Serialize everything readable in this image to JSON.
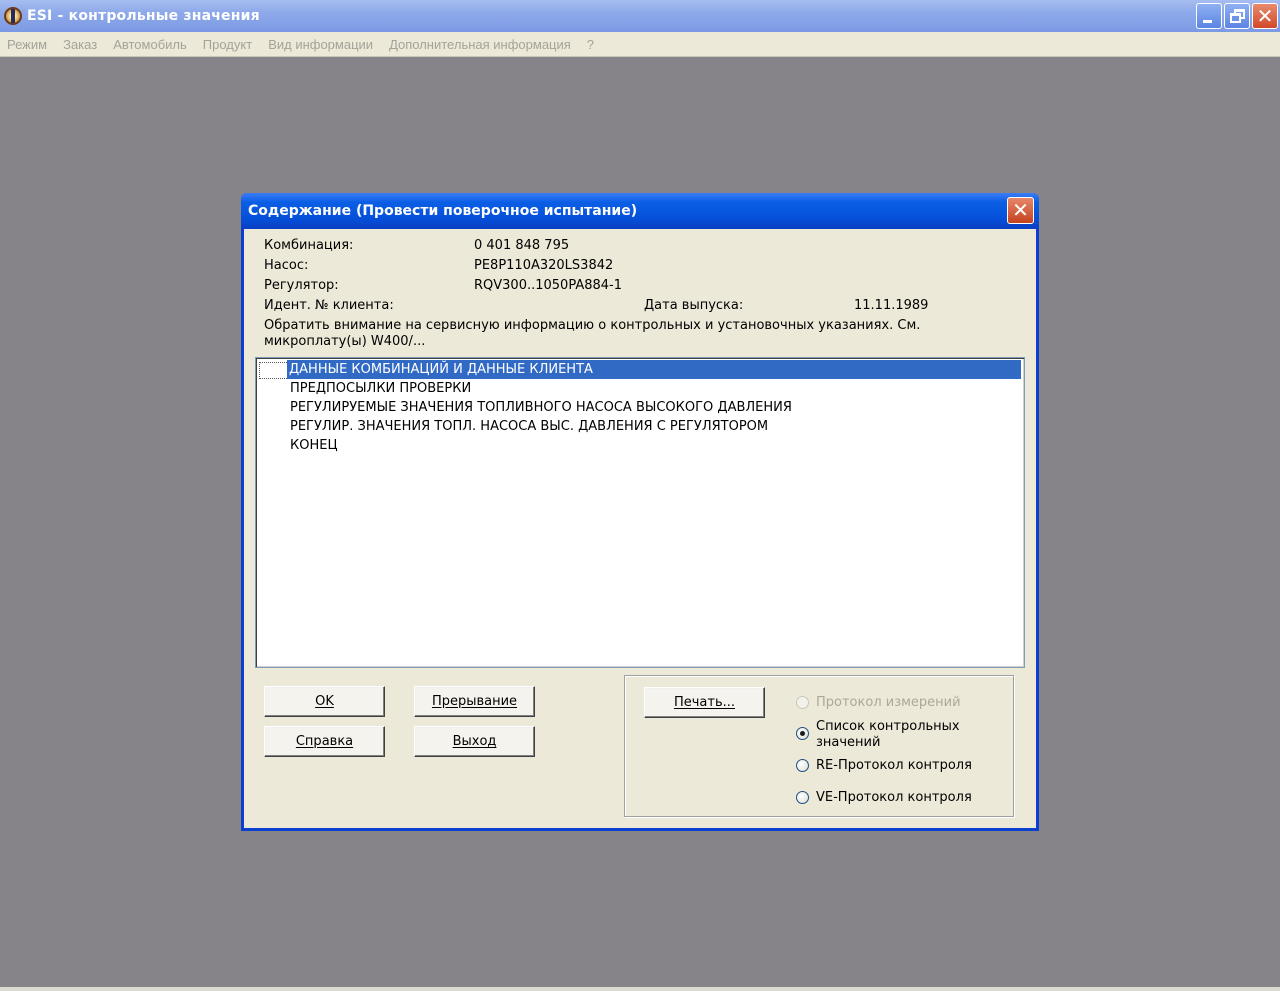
{
  "window": {
    "title": "ESI - контрольные значения"
  },
  "menu": [
    "Режим",
    "Заказ",
    "Автомобиль",
    "Продукт",
    "Вид информации",
    "Дополнительная информация",
    "?"
  ],
  "dialog": {
    "title": "Содержание (Провести поверочное испытание)",
    "fields": {
      "combination_label": "Комбинация:",
      "combination_value": "0 401 848 795",
      "pump_label": "Насос:",
      "pump_value": "PE8P110A320LS3842",
      "regulator_label": "Регулятор:",
      "regulator_value": "RQV300..1050PA884-1",
      "client_id_label": "Идент. № клиента:",
      "release_date_label": "Дата выпуска:",
      "release_date_value": "11.11.1989"
    },
    "notice_line1": "Обратить внимание на сервисную информацию о контрольных и установочных указаниях. См.",
    "notice_line2": "микроплату(ы) W400/...",
    "list_items": [
      "ДАННЫЕ КОМБИНАЦИЙ И ДАННЫЕ КЛИЕНТА",
      "ПРЕДПОСЫЛКИ ПРОВЕРКИ",
      "РЕГУЛИРУЕМЫЕ ЗНАЧЕНИЯ ТОПЛИВНОГО НАСОСА ВЫСОКОГО ДАВЛЕНИЯ",
      "РЕГУЛИР. ЗНАЧЕНИЯ ТОПЛ. НАСОСА ВЫС. ДАВЛЕНИЯ С РЕГУЛЯТОРОМ",
      "КОНЕЦ"
    ],
    "selected_index": 0,
    "buttons": {
      "ok": "OK",
      "abort": "Прерывание",
      "help": "Справка",
      "exit": "Выход",
      "print": "Печать..."
    },
    "print_options": {
      "measure_protocol": "Протокол измерений",
      "control_list_line1": "Список контрольных",
      "control_list_line2": "значений",
      "re_protocol": "RE-Протокол контроля",
      "ve_protocol": "VE-Протокол контроля",
      "selected": "control_list"
    }
  }
}
